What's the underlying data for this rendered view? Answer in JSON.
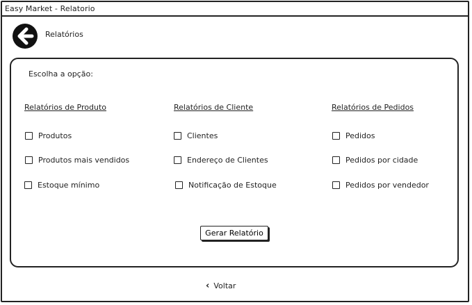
{
  "window": {
    "title": "Easy Market - Relatorio"
  },
  "header": {
    "title": "Relatórios",
    "back_icon": "arrow-left-circle-icon"
  },
  "panel": {
    "prompt": "Escolha a opção:",
    "groups": [
      {
        "title": "Relatórios de Produto",
        "options": [
          "Produtos",
          "Produtos mais vendidos",
          "Estoque mínimo"
        ]
      },
      {
        "title": "Relatórios de Cliente",
        "options": [
          "Clientes",
          "Endereço de Clientes",
          "Notificação de Estoque"
        ]
      },
      {
        "title": "Relatórios de Pedidos",
        "options": [
          "Pedidos",
          "Pedidos por cidade",
          "Pedidos por vendedor"
        ]
      }
    ],
    "generate_label": "Gerar Relatório"
  },
  "footer": {
    "back_label": "Voltar",
    "back_icon": "chevron-left-icon"
  }
}
